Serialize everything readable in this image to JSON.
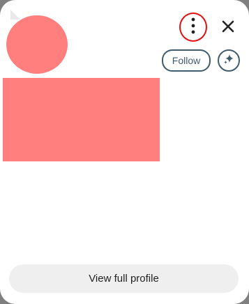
{
  "profile_card": {
    "follow_label": "Follow",
    "view_full_profile_label": "View full profile"
  },
  "icons": {
    "more": "more-vertical-icon",
    "close": "close-icon",
    "sparkle": "sparkle-icon"
  },
  "colors": {
    "placeholder_fill": "#ff7f7f",
    "highlight_ring": "#e01010",
    "accent": "#3f5b6e",
    "button_bg": "#efefef"
  }
}
